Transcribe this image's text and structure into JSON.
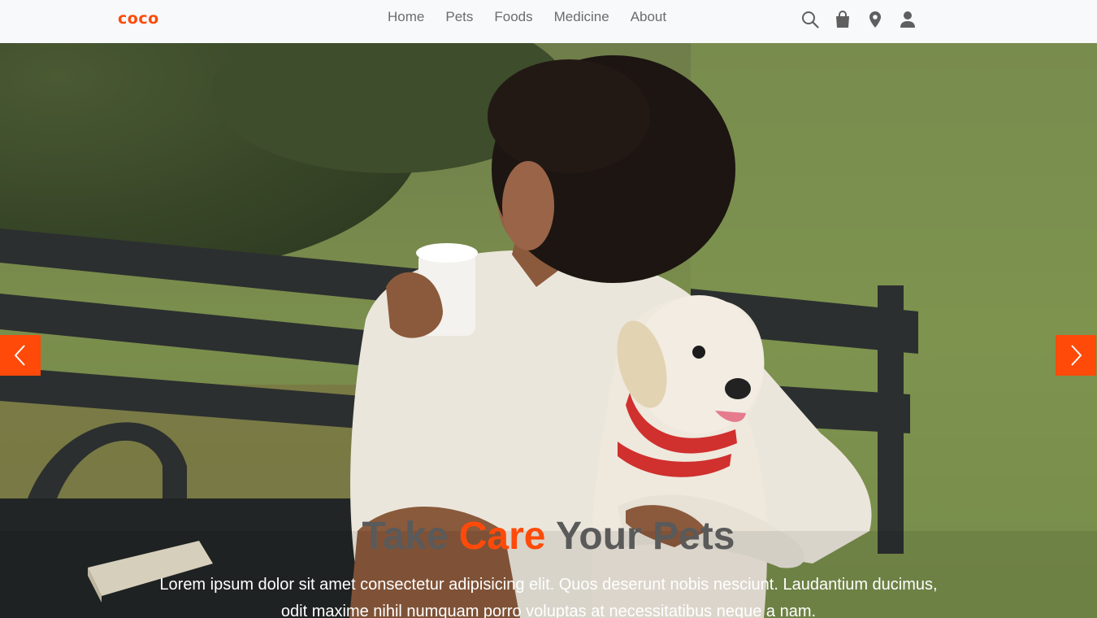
{
  "brand": "coco",
  "nav": {
    "links": [
      "Home",
      "Pets",
      "Foods",
      "Medicine",
      "About"
    ],
    "icons": [
      "search-icon",
      "shopping-bag-icon",
      "map-marker-icon",
      "user-icon"
    ]
  },
  "hero": {
    "title_before": "Take ",
    "title_accent": "Care",
    "title_after": " Your Pets",
    "text": "Lorem ipsum dolor sit amet consectetur adipisicing elit. Quos deserunt nobis nesciunt. Laudantium ducimus, odit maxime nihil numquam porro voluptas at necessitatibus neque a nam.",
    "prev_icon": "chevron-left-icon",
    "next_icon": "chevron-right-icon"
  },
  "colors": {
    "accent": "#ff4a0a",
    "navbar_bg": "#f8f9fa",
    "nav_text": "#6c6c6c"
  }
}
